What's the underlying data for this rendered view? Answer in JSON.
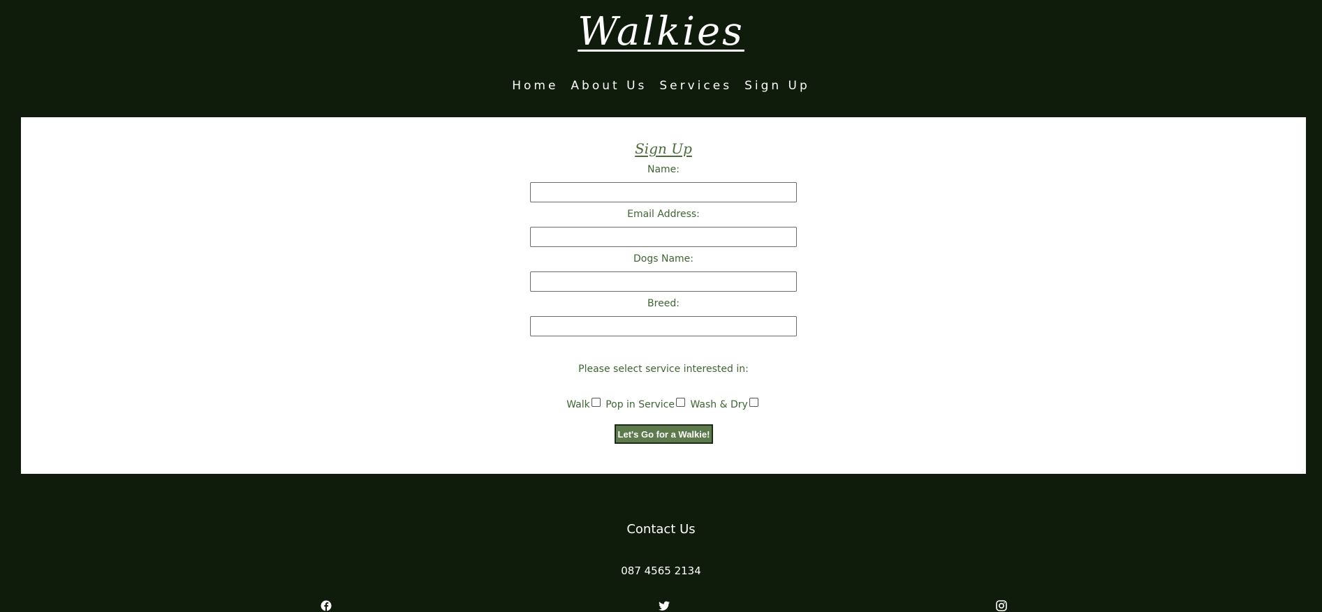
{
  "header": {
    "site_title": "Walkies",
    "nav": [
      "Home",
      "About Us",
      "Services",
      "Sign Up"
    ]
  },
  "form": {
    "title": "Sign Up",
    "fields": [
      {
        "label": "Name:",
        "value": "",
        "placeholder": ""
      },
      {
        "label": "Email Address:",
        "value": "",
        "placeholder": ""
      },
      {
        "label": "Dogs Name:",
        "value": "",
        "placeholder": ""
      },
      {
        "label": "Breed:",
        "value": "",
        "placeholder": ""
      }
    ],
    "services_prompt": "Please select service interested in:",
    "services": [
      {
        "label": "Walk",
        "checked": false
      },
      {
        "label": "Pop in Service",
        "checked": false
      },
      {
        "label": "Wash & Dry",
        "checked": false
      }
    ],
    "submit_label": "Let's Go for a Walkie!"
  },
  "footer": {
    "contact_title": "Contact Us",
    "phone": "087 4565 2134",
    "social_icons": [
      "facebook-icon",
      "twitter-icon",
      "instagram-icon"
    ]
  },
  "colors": {
    "background": "#0f1c0c",
    "card": "#ffffff",
    "accent_text": "#3f6434",
    "button": "#5c7a4c"
  }
}
